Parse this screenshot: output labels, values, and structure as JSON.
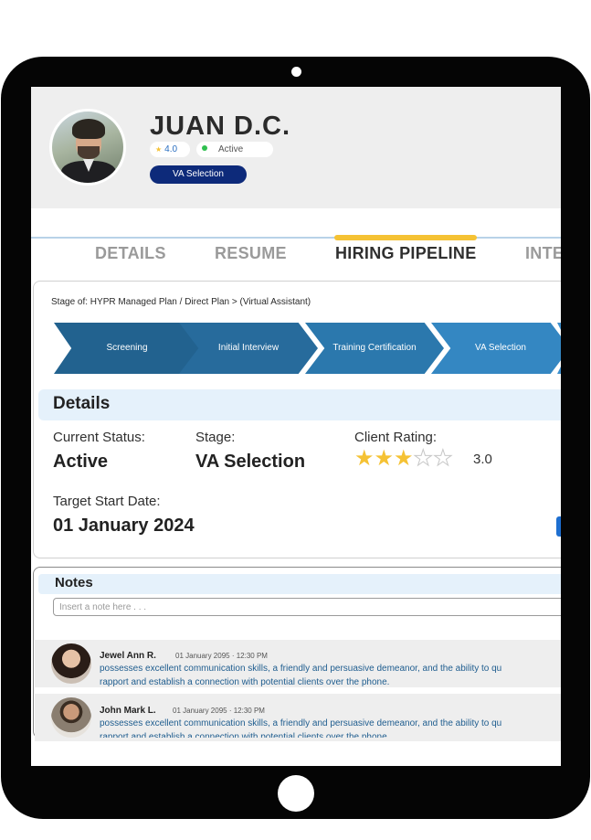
{
  "profile": {
    "name": "JUAN D.C.",
    "rating": "4.0",
    "status": "Active",
    "stage_badge": "VA Selection"
  },
  "tabs": [
    {
      "label": "DETAILS",
      "active": false
    },
    {
      "label": "RESUME",
      "active": false
    },
    {
      "label": "HIRING PIPELINE",
      "active": true
    },
    {
      "label": "INTE",
      "active": false
    }
  ],
  "pipeline": {
    "stage_of": "Stage of: HYPR Managed Plan / Direct Plan > (Virtual Assistant)",
    "stages": [
      "Screening",
      "Initial Interview",
      "Training Certification",
      "VA Selection"
    ]
  },
  "details": {
    "title": "Details",
    "current_status_label": "Current Status:",
    "current_status_value": "Active",
    "stage_label": "Stage:",
    "stage_value": "VA Selection",
    "client_rating_label": "Client Rating:",
    "client_rating_value": "3.0",
    "client_rating_stars": 3,
    "target_start_label": "Target Start Date:",
    "target_start_value": "01 January 2024"
  },
  "notes": {
    "title": "Notes",
    "input_placeholder": "Insert a note here . . .",
    "items": [
      {
        "author": "Jewel Ann R.",
        "timestamp": "01 January 2095  ·  12:30 PM",
        "line1": "possesses excellent communication skills, a friendly and persuasive demeanor, and the ability to qu",
        "line2": "rapport and establish a connection with potential clients over the phone."
      },
      {
        "author": "John Mark L.",
        "timestamp": "01 January 2095  ·  12:30 PM",
        "line1": "possesses excellent communication skills, a friendly and persuasive demeanor, and the ability to qu",
        "line2": "rapport and establish a connection with potential clients over the phone."
      }
    ]
  },
  "colors": {
    "accent_yellow": "#f5c234",
    "badge_navy": "#0d2a7a",
    "pipeline_blue": "#2b78ad",
    "status_green": "#2fbf4f"
  }
}
